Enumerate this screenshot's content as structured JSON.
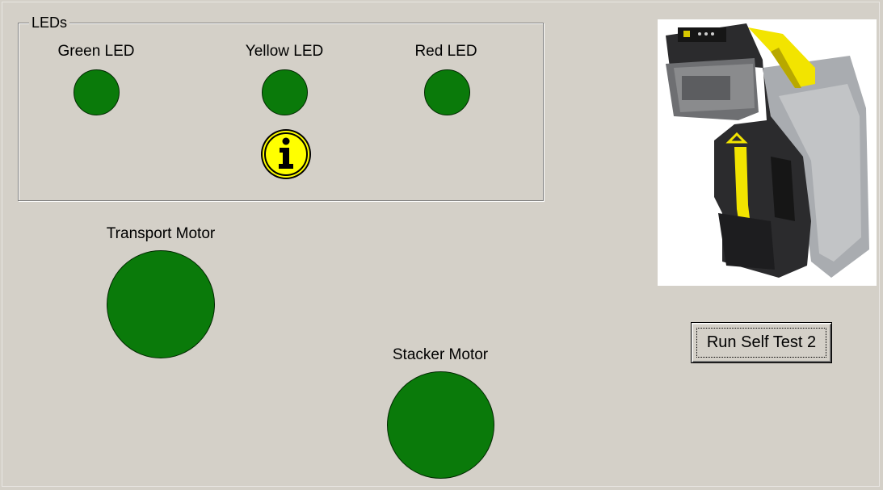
{
  "leds_group": {
    "title": "LEDs",
    "green_label": "Green LED",
    "yellow_label": "Yellow LED",
    "red_label": "Red LED",
    "info_icon": "info-icon",
    "led_color": "#0a7a0a"
  },
  "motors": {
    "transport_label": "Transport Motor",
    "stacker_label": "Stacker Motor"
  },
  "device_image": "bill-validator-photo",
  "buttons": {
    "self_test_label": "Run Self Test 2"
  },
  "colors": {
    "background": "#d4d0c8",
    "indicator_on": "#0a7a0a",
    "info_yellow": "#ffff00"
  }
}
